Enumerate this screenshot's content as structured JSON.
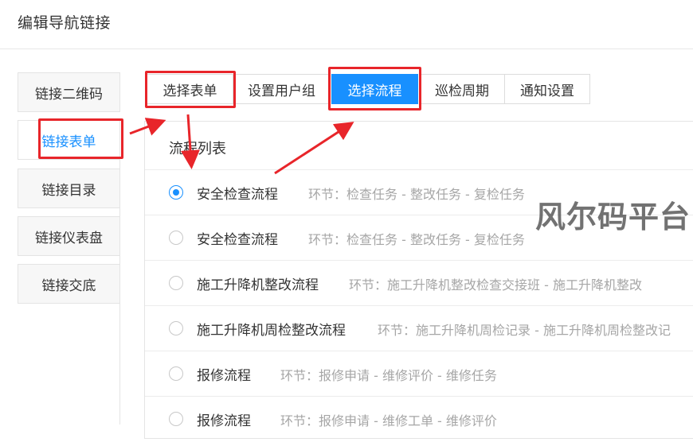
{
  "page": {
    "title": "编辑导航链接"
  },
  "side_tabs": [
    {
      "label": "链接二维码"
    },
    {
      "label": "链接表单"
    },
    {
      "label": "链接目录"
    },
    {
      "label": "链接仪表盘"
    },
    {
      "label": "链接交底"
    }
  ],
  "top_tabs": [
    {
      "label": "选择表单"
    },
    {
      "label": "设置用户组"
    },
    {
      "label": "选择流程"
    },
    {
      "label": "巡检周期"
    },
    {
      "label": "通知设置"
    }
  ],
  "panel": {
    "title": "流程列表",
    "flows": [
      {
        "name": "安全检查流程",
        "steps": "环节：检查任务 - 整改任务 - 复检任务",
        "selected": true
      },
      {
        "name": "安全检查流程",
        "steps": "环节：检查任务 - 整改任务 - 复检任务",
        "selected": false
      },
      {
        "name": "施工升降机整改流程",
        "steps": "环节：施工升降机整改检查交接班 - 施工升降机整改",
        "selected": false
      },
      {
        "name": "施工升降机周检整改流程",
        "steps": "环节：施工升降机周检记录 - 施工升降机周检整改记",
        "selected": false
      },
      {
        "name": "报修流程",
        "steps": "环节：报修申请 - 维修评价 - 维修任务",
        "selected": false
      },
      {
        "name": "报修流程",
        "steps": "环节：报修申请 - 维修工单 - 维修评价",
        "selected": false
      }
    ]
  },
  "watermark": "风尔码平台",
  "colors": {
    "accent": "#1890ff",
    "highlight": "#e8252a"
  }
}
